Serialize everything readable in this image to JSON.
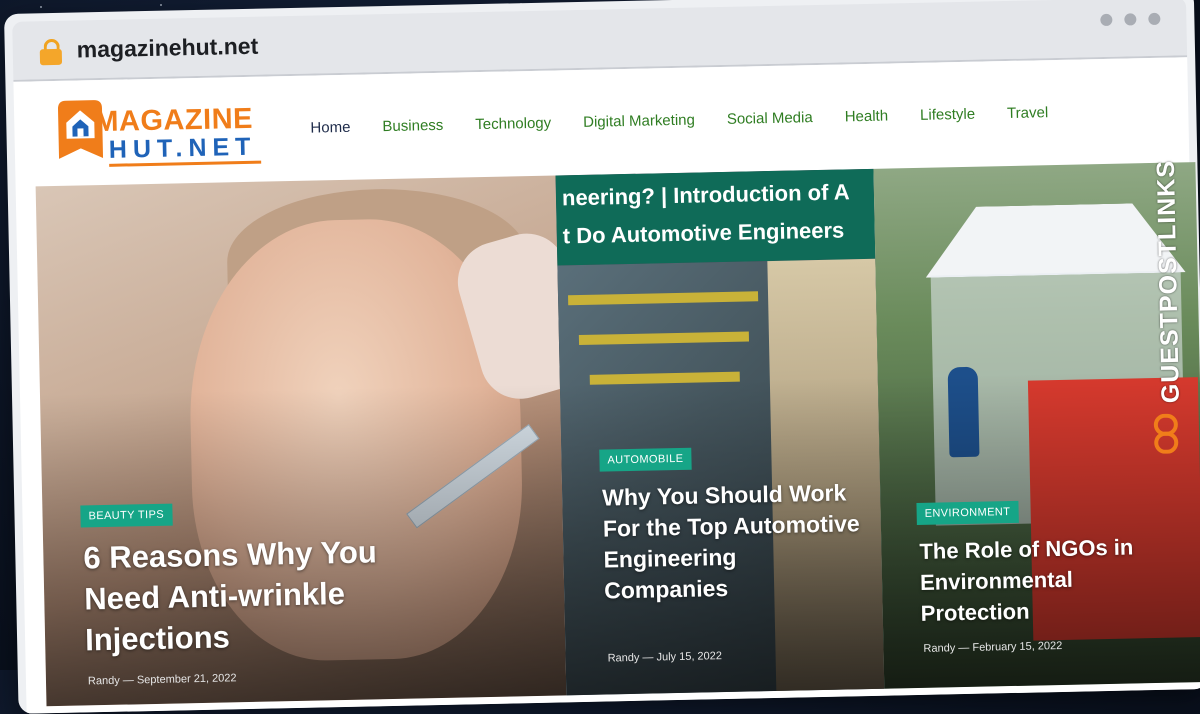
{
  "browser": {
    "url": "magazinehut.net"
  },
  "site": {
    "logo_line1": "MAGAZINE",
    "logo_line2": "HUT.NET"
  },
  "nav": {
    "items": [
      {
        "label": "Home",
        "active": true
      },
      {
        "label": "Business"
      },
      {
        "label": "Technology"
      },
      {
        "label": "Digital Marketing"
      },
      {
        "label": "Social Media"
      },
      {
        "label": "Health"
      },
      {
        "label": "Lifestyle"
      },
      {
        "label": "Travel"
      }
    ]
  },
  "articles": [
    {
      "category": "BEAUTY TIPS",
      "title": "6 Reasons Why You Need Anti-wrinkle Injections",
      "author": "Randy",
      "date": "September 21, 2022"
    },
    {
      "category": "AUTOMOBILE",
      "image_banner_line1": "neering? | Introduction of A",
      "image_banner_line2": "t Do Automotive Engineers",
      "title": "Why You Should Work For the Top Automotive Engineering Companies",
      "author": "Randy",
      "date": "July 15, 2022"
    },
    {
      "category": "ENVIRONMENT",
      "title": "The Role of NGOs in Environmental Protection",
      "author": "Randy",
      "date": "February 15, 2022"
    }
  ],
  "watermark": {
    "text": "GUESTPOSTLINKS"
  },
  "colors": {
    "nav_green": "#2f7d22",
    "tag_green": "#16a587",
    "logo_orange": "#f07d1a",
    "logo_blue": "#1f63b8"
  }
}
